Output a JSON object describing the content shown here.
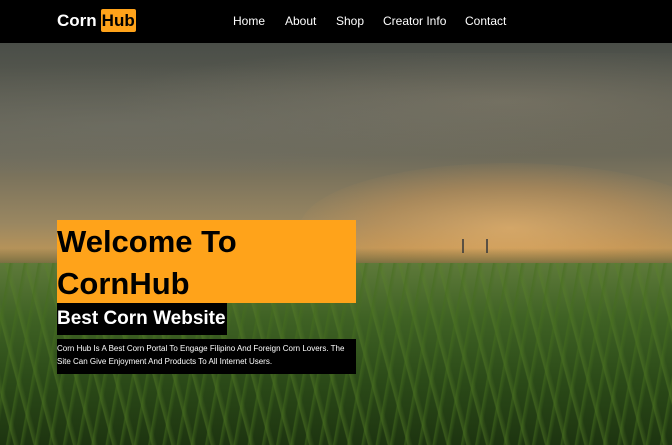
{
  "brand": {
    "logo_part1": "Corn",
    "logo_part2": "Hub",
    "accent_color": "#ffa31a"
  },
  "nav": {
    "items": [
      {
        "label": "Home"
      },
      {
        "label": "About"
      },
      {
        "label": "Shop"
      },
      {
        "label": "Creator Info"
      },
      {
        "label": "Contact"
      }
    ]
  },
  "hero": {
    "background": "cornfield-sunset-image",
    "title": "Welcome To CornHub",
    "subtitle": "Best Corn Website",
    "description": "Corn Hub Is A Best Corn Portal To Engage Filipino And Foreign Corn Lovers. The Site Can Give Enjoyment And Products To All Internet Users."
  }
}
